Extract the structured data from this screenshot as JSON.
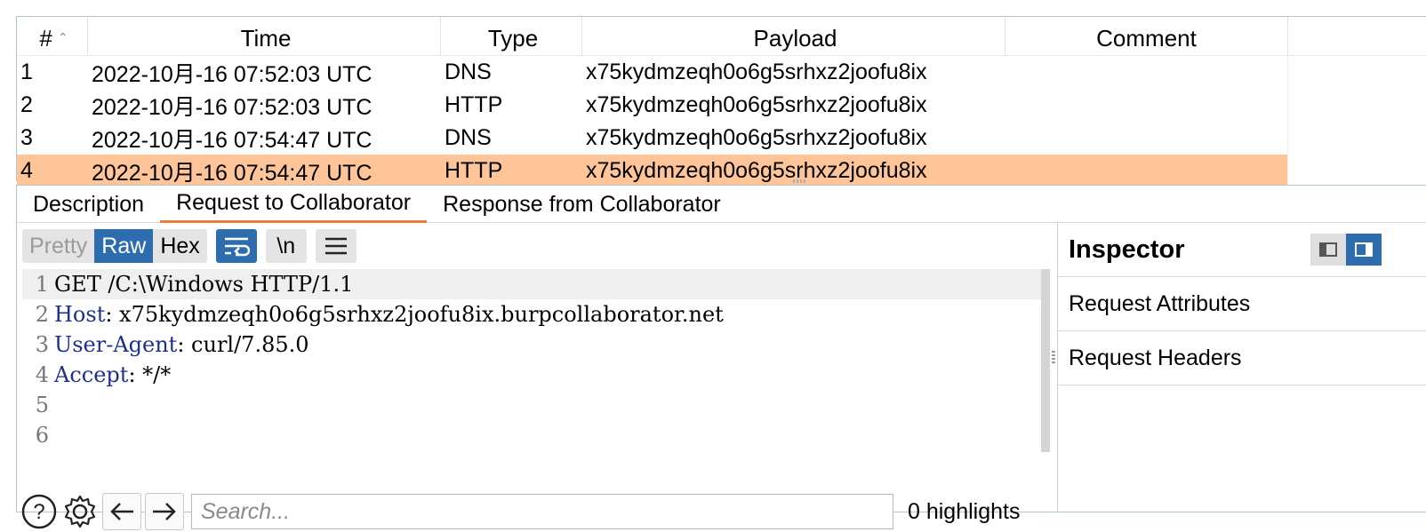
{
  "table": {
    "headers": [
      "#",
      "Time",
      "Type",
      "Payload",
      "Comment",
      ""
    ],
    "rows": [
      {
        "num": "1",
        "time": "2022-10月-16 07:52:03 UTC",
        "type": "DNS",
        "payload": "x75kydmzeqh0o6g5srhxz2joofu8ix",
        "comment": ""
      },
      {
        "num": "2",
        "time": "2022-10月-16 07:52:03 UTC",
        "type": "HTTP",
        "payload": "x75kydmzeqh0o6g5srhxz2joofu8ix",
        "comment": ""
      },
      {
        "num": "3",
        "time": "2022-10月-16 07:54:47 UTC",
        "type": "DNS",
        "payload": "x75kydmzeqh0o6g5srhxz2joofu8ix",
        "comment": ""
      },
      {
        "num": "4",
        "time": "2022-10月-16 07:54:47 UTC",
        "type": "HTTP",
        "payload": "x75kydmzeqh0o6g5srhxz2joofu8ix",
        "comment": ""
      }
    ],
    "selected_row": "4"
  },
  "tabs": [
    "Description",
    "Request to Collaborator",
    "Response from Collaborator"
  ],
  "editor": {
    "modes": [
      "Pretty",
      "Raw",
      "Hex"
    ],
    "active_mode": "Raw",
    "newline_label": "\\n",
    "lines": [
      {
        "num": "1",
        "key": "",
        "rest": "GET /C:\\Windows HTTP/1.1"
      },
      {
        "num": "2",
        "key": "Host",
        "rest": ": x75kydmzeqh0o6g5srhxz2joofu8ix.burpcollaborator.net"
      },
      {
        "num": "3",
        "key": "User-Agent",
        "rest": ": curl/7.85.0"
      },
      {
        "num": "4",
        "key": "Accept",
        "rest": ": */*"
      },
      {
        "num": "5",
        "key": "",
        "rest": ""
      },
      {
        "num": "6",
        "key": "",
        "rest": ""
      }
    ]
  },
  "search": {
    "placeholder": "Search...",
    "value": "",
    "highlights": "0 highlights"
  },
  "inspector": {
    "title": "Inspector",
    "sections": [
      "Request Attributes",
      "Request Headers"
    ]
  },
  "colors": {
    "selected_row": "#ffc599",
    "accent_blue": "#2d6dad",
    "tab_underline": "#e8803a",
    "header_key": "#1f2f8c"
  }
}
